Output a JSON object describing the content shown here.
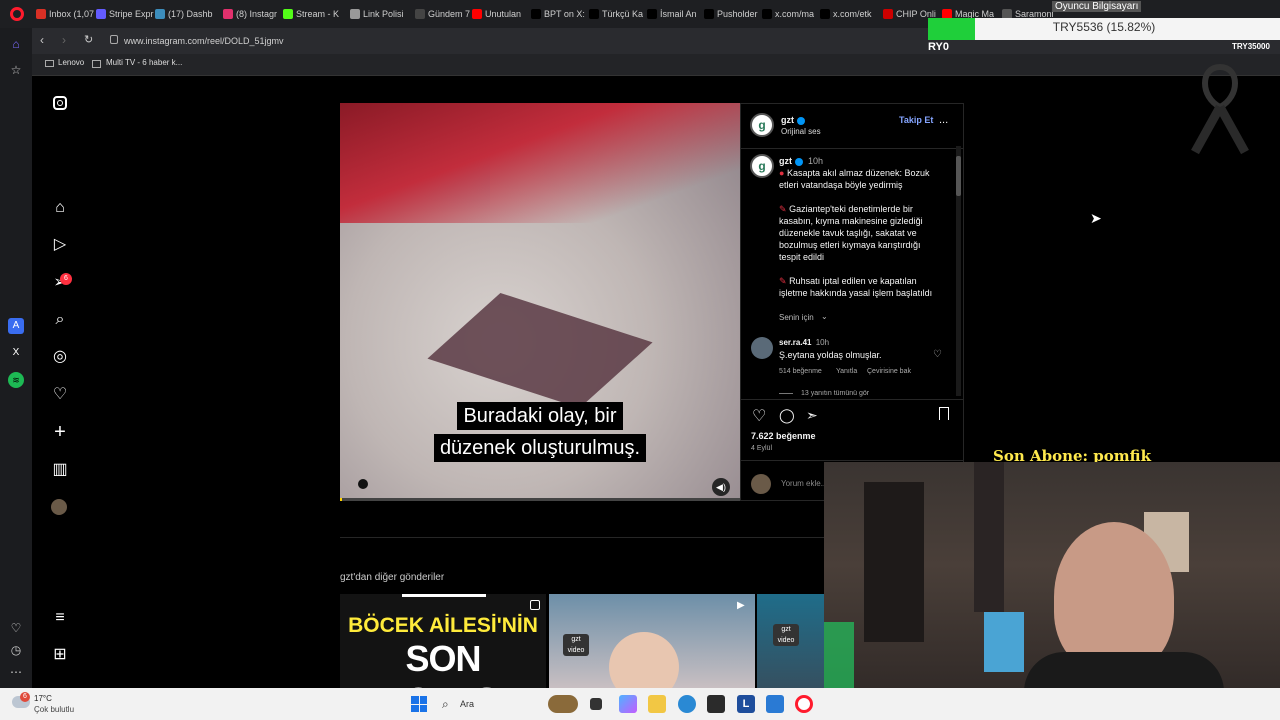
{
  "browser": {
    "tabs": [
      {
        "label": "Inbox (1,07",
        "color": "#d93025"
      },
      {
        "label": "Stripe Expr",
        "color": "#635bff"
      },
      {
        "label": "(17) Dashb",
        "color": "#3c8dbc"
      },
      {
        "label": "(8) Instagr",
        "color": "#e1306c"
      },
      {
        "label": "Stream - K",
        "color": "#53fc18"
      },
      {
        "label": "Link Polisi",
        "color": "#999999"
      },
      {
        "label": "Gündem 7",
        "color": "#444444"
      },
      {
        "label": "Unutulan",
        "color": "#ff0000"
      },
      {
        "label": "BPT on X:",
        "color": "#000000"
      },
      {
        "label": "Türkçü Ka",
        "color": "#000000"
      },
      {
        "label": "İsmail An",
        "color": "#000000"
      },
      {
        "label": "Pusholder",
        "color": "#000000"
      },
      {
        "label": "x.com/ma",
        "color": "#000000"
      },
      {
        "label": "x.com/etk",
        "color": "#000000"
      },
      {
        "label": "CHIP Onli",
        "color": "#cc0000"
      },
      {
        "label": "Magic Ma",
        "color": "#ff0000"
      },
      {
        "label": "Saramoni",
        "color": "#555555"
      }
    ],
    "url": "www.instagram.com/reel/DOLD_51jgmv",
    "bookmarks": [
      "Lenovo",
      "Multi TV - 6 haber k..."
    ]
  },
  "instagram": {
    "post": {
      "username": "gzt",
      "audio": "Orijinal ses",
      "follow_label": "Takip Et",
      "more": "...",
      "time": "10h",
      "caption_line1": "Kasapta akıl almaz düzenek: Bozuk etleri vatandaşa böyle yedirmiş",
      "caption_line2": "Gaziantep'teki denetimlerde bir kasabın, kıyma makinesine gizlediği düzenekle tavuk taşlığı, sakatat ve bozulmuş etleri kıymaya karıştırdığı tespit edildi",
      "caption_line3": "Ruhsatı iptal edilen ve kapatılan işletme hakkında yasal işlem başlatıldı",
      "for_you": "Senin için",
      "comment": {
        "user": "ser.ra.41",
        "time": "10h",
        "text": "Ş.eytana yoldaş olmuşlar.",
        "likes": "514 beğenme",
        "reply": "Yanıtla",
        "translate": "Çevirisine bak",
        "view_replies": "13 yanıtın tümünü gör"
      },
      "likes": "7.622 beğenme",
      "date": "4 Eylül",
      "comment_placeholder": "Yorum ekle...",
      "subtitle_line1": "Buradaki olay, bir",
      "subtitle_line2": "düzenek oluşturulmuş."
    },
    "more_posts_title": "gzt'dan diğer gönderiler",
    "thumb1_line1": "BÖCEK AİLESİ'NİN",
    "thumb1_line2": "SON ROTASI",
    "thumb_badge": "gzt video",
    "notification_count": "6"
  },
  "stream_overlay": {
    "donation_title": "Oyuncu Bilgisayarı",
    "donation_progress": "TRY5536 (15.82%)",
    "donation_fraction": 0.1582,
    "left_label": "RY0",
    "right_label": "TRY35000",
    "last_sub": "Son Abone: pomfik"
  },
  "taskbar": {
    "weather_temp": "17°C",
    "weather_desc": "Çok bulutlu",
    "search": "Ara",
    "weather_badge": "6"
  }
}
